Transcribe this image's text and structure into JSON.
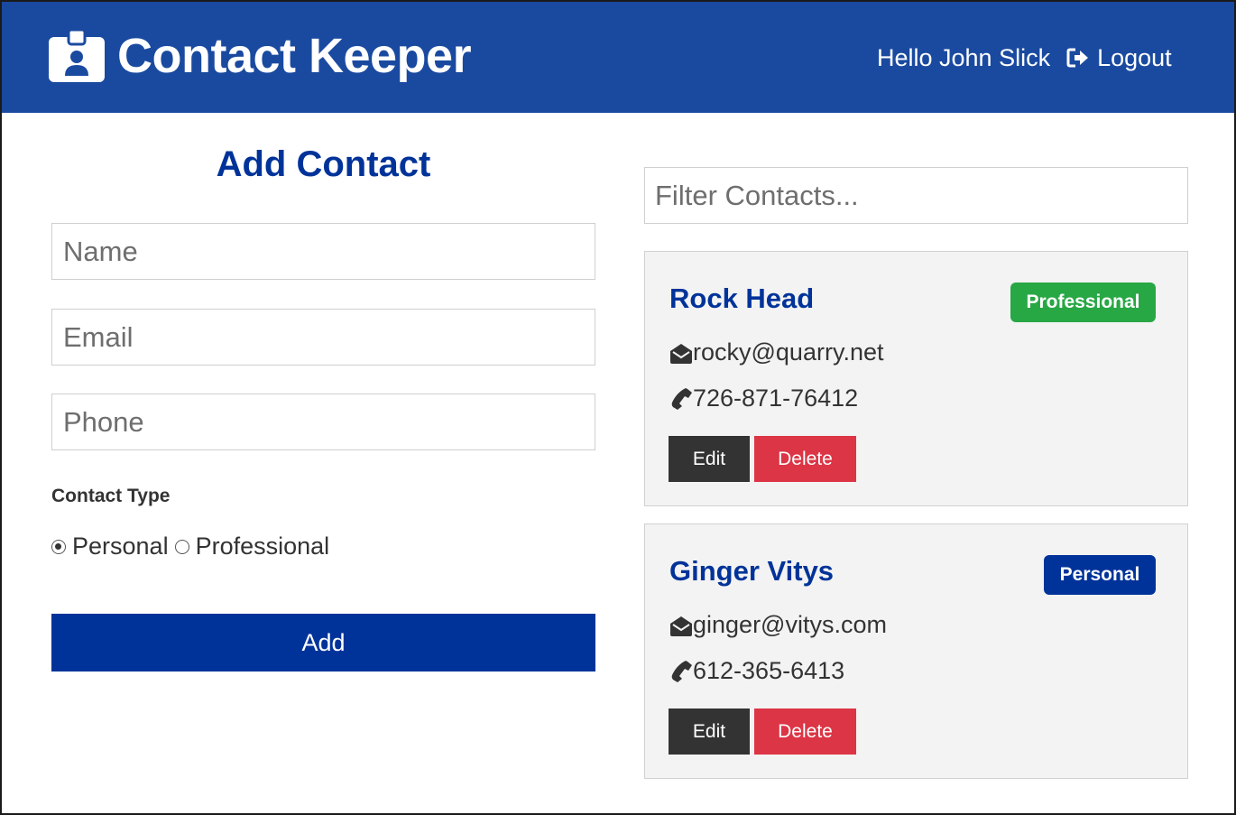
{
  "app": {
    "title": "Contact Keeper",
    "greeting": "Hello John Slick",
    "logout_label": "Logout"
  },
  "form": {
    "title": "Add Contact",
    "name_placeholder": "Name",
    "email_placeholder": "Email",
    "phone_placeholder": "Phone",
    "contact_type_label": "Contact Type",
    "options": [
      {
        "label": "Personal",
        "checked": true
      },
      {
        "label": "Professional",
        "checked": false
      }
    ],
    "submit_label": "Add"
  },
  "filter": {
    "placeholder": "Filter Contacts..."
  },
  "contacts": [
    {
      "name": "Rock Head",
      "type_label": "Professional",
      "email": "rocky@quarry.net",
      "phone": "726-871-76412",
      "edit_label": "Edit",
      "delete_label": "Delete"
    },
    {
      "name": "Ginger Vitys",
      "type_label": "Personal",
      "email": "ginger@vitys.com",
      "phone": "612-365-6413",
      "edit_label": "Edit",
      "delete_label": "Delete"
    }
  ],
  "colors": {
    "navbar": "#1a4aa0",
    "primary": "#003399",
    "success": "#28a745",
    "danger": "#dc3545",
    "dark": "#333333"
  },
  "icons": {
    "brand": "id-badge-icon",
    "logout": "sign-out-icon",
    "email": "envelope-open-icon",
    "phone": "phone-icon"
  }
}
